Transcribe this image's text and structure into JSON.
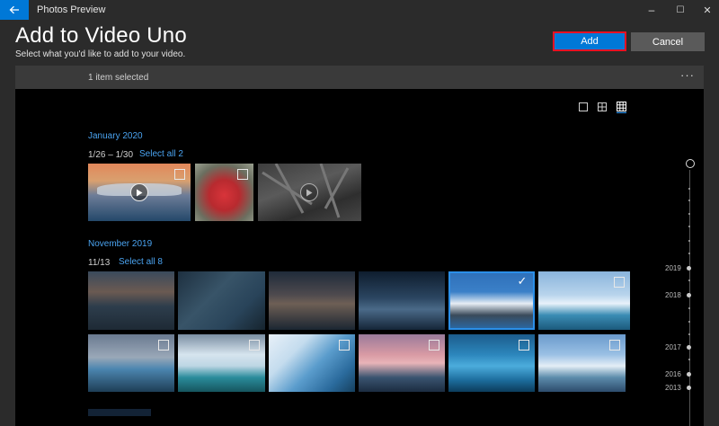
{
  "window": {
    "app_title": "Photos Preview",
    "min_glyph": "–",
    "max_glyph": "☐",
    "close_glyph": "✕"
  },
  "header": {
    "title": "Add to Video Uno",
    "subtitle": "Select what you'd like to add to your video.",
    "add_label": "Add",
    "cancel_label": "Cancel"
  },
  "selection": {
    "status": "1 item selected",
    "more_glyph": "···"
  },
  "views": [
    "single-view-icon",
    "four-grid-view-icon",
    "nine-grid-view-icon"
  ],
  "groups": [
    {
      "month": "January 2020",
      "range": "1/26 – 1/30",
      "select_all": "Select all 2",
      "items": [
        {
          "name": "photo-lake-reflection-video",
          "video": true,
          "selected": false
        },
        {
          "name": "photo-apple",
          "video": false,
          "selected": false
        },
        {
          "name": "photo-branches-video",
          "video": true,
          "selected": false
        }
      ]
    },
    {
      "month": "November 2019",
      "range": "11/13",
      "select_all": "Select all 8",
      "items": [
        {
          "name": "photo-lake-dusk"
        },
        {
          "name": "photo-glacier-blue"
        },
        {
          "name": "photo-sea-dusk"
        },
        {
          "name": "photo-night-mountain"
        },
        {
          "name": "photo-snowy-mountain",
          "selected": true
        },
        {
          "name": "photo-iceberg-sky"
        },
        {
          "name": "photo-iceberg-sea"
        },
        {
          "name": "photo-iceberg-turquoise"
        },
        {
          "name": "photo-ice-cliff"
        },
        {
          "name": "photo-pink-peaks"
        },
        {
          "name": "photo-ice-wave"
        },
        {
          "name": "photo-iceberg-wide"
        }
      ]
    }
  ],
  "timeline": {
    "years": [
      "2019",
      "2018",
      "2017",
      "2016",
      "2013"
    ]
  },
  "colors": {
    "accent": "#0078d7",
    "link": "#4aa3f0",
    "highlight_border": "#e81123"
  }
}
